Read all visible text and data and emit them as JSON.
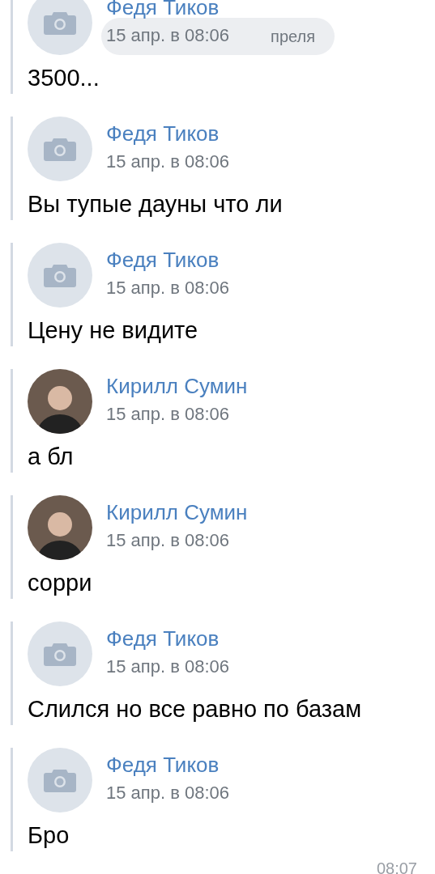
{
  "date_pill": {
    "label": "преля"
  },
  "messages": [
    {
      "author": "Федя Тиков",
      "date": "15 апр. в 08:06",
      "text": "3500...",
      "kind": "camera"
    },
    {
      "author": "Федя Тиков",
      "date": "15 апр. в 08:06",
      "text": "Вы тупые дауны что ли",
      "kind": "camera"
    },
    {
      "author": "Федя Тиков",
      "date": "15 апр. в 08:06",
      "text": "Цену не видите",
      "kind": "camera"
    },
    {
      "author": "Кирилл Сумин",
      "date": "15 апр. в 08:06",
      "text": "а бл",
      "kind": "photo"
    },
    {
      "author": "Кирилл Сумин",
      "date": "15 апр. в 08:06",
      "text": "сорри",
      "kind": "photo"
    },
    {
      "author": "Федя Тиков",
      "date": "15 апр. в 08:06",
      "text": "Слился но все равно по базам",
      "kind": "camera"
    },
    {
      "author": "Федя Тиков",
      "date": "15 апр. в 08:06",
      "text": "Бро",
      "kind": "camera"
    }
  ],
  "time": "08:07"
}
